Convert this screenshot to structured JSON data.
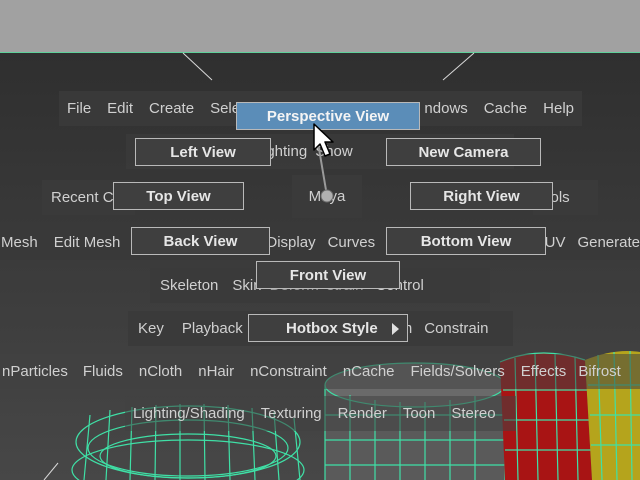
{
  "main_menu": {
    "file": "File",
    "edit": "Edit",
    "create": "Create",
    "select": "Sele",
    "windows": "ndows",
    "cache": "Cache",
    "help": "Help"
  },
  "panels_row": {
    "lighting": "ighting",
    "show": "Show"
  },
  "center_row": {
    "recent": "Recent Co",
    "maya": "Maya",
    "controls": "ntrols"
  },
  "modeling_row": {
    "mesh": "Mesh",
    "edit_mesh": "Edit Mesh",
    "display": "Display",
    "curves": "Curves",
    "uv": "UV",
    "generate": "Generate"
  },
  "rigging_row": {
    "skeleton": "Skeleton",
    "skin": "Skin",
    "deform": "Deform",
    "constrain": "strain",
    "control": "Control"
  },
  "animation_row": {
    "key": "Key",
    "playback": "Playback",
    "form": "rm",
    "constrain": "Constrain"
  },
  "fx_row": {
    "nparticles": "nParticles",
    "fluids": "Fluids",
    "ncloth": "nCloth",
    "nhair": "nHair",
    "nconstraint": "nConstraint",
    "ncache": "nCache",
    "fields": "Fields/Solvers",
    "effects": "Effects",
    "bifrost": "Bifrost"
  },
  "rendering_row": {
    "lighting_shading": "Lighting/Shading",
    "texturing": "Texturing",
    "render": "Render",
    "toon": "Toon",
    "stereo": "Stereo"
  },
  "marking_menu": {
    "perspective": "Perspective View",
    "left": "Left View",
    "new_camera": "New Camera",
    "top": "Top View",
    "right": "Right View",
    "back": "Back View",
    "bottom": "Bottom View",
    "front": "Front View",
    "hotbox_style": "Hotbox Style"
  },
  "colors": {
    "accent": "#5b8db8",
    "wireframe": "#3fe0a6",
    "red_mesh": "#a81414",
    "yellow_mesh": "#b5a41c"
  }
}
